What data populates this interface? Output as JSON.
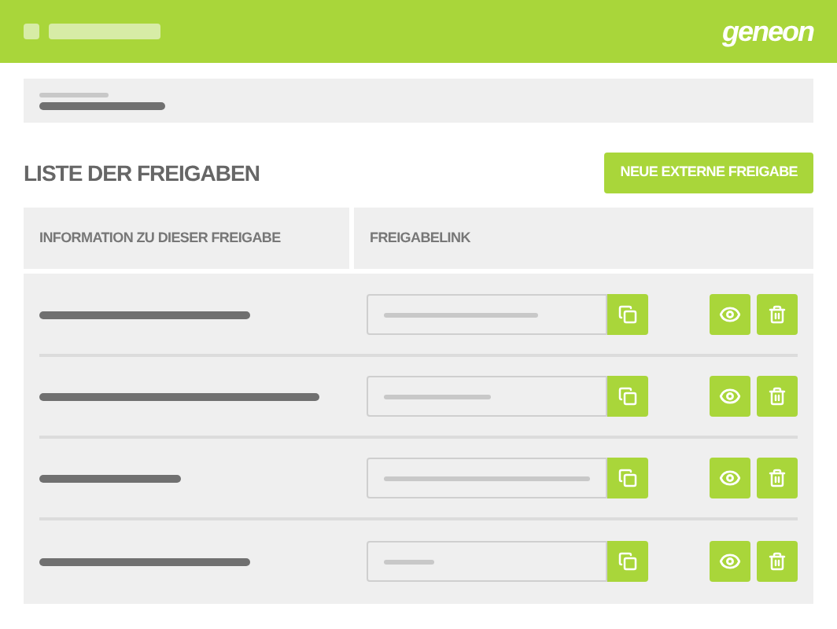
{
  "header": {
    "logo": "geneon"
  },
  "section": {
    "title": "LISTE DER FREIGABEN",
    "new_button": "NEUE EXTERNE FREIGABE"
  },
  "table": {
    "columns": [
      "INFORMATION ZU DIESER FREIGABE",
      "FREIGABELINK"
    ],
    "rows": [
      {
        "kind": "share"
      },
      {
        "kind": "share"
      },
      {
        "kind": "share"
      },
      {
        "kind": "share"
      }
    ]
  }
}
